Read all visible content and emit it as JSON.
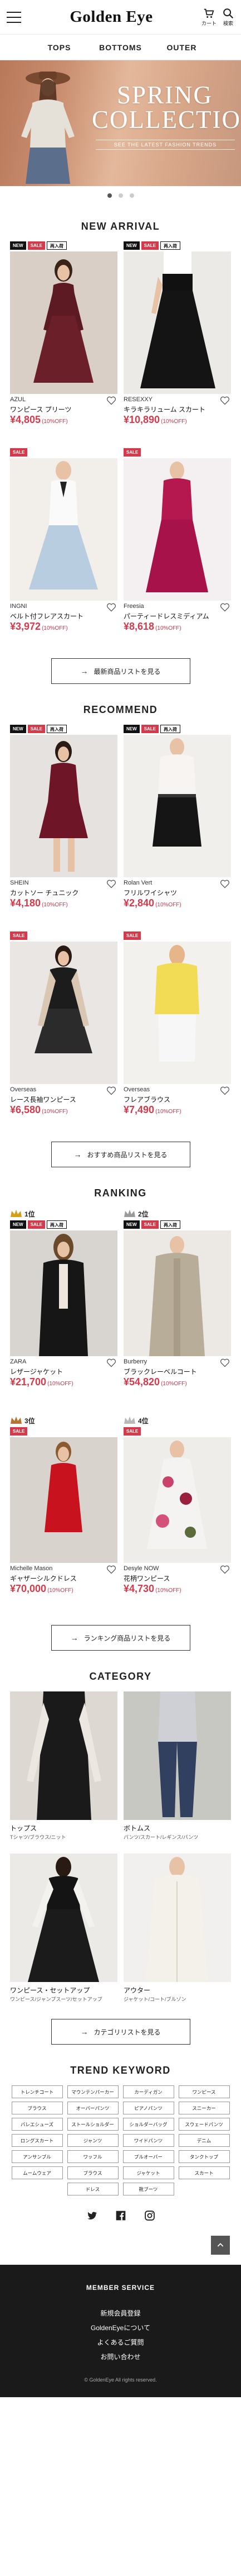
{
  "header": {
    "logo": "Golden Eye",
    "cart_label": "カート",
    "search_label": "検索"
  },
  "nav": {
    "tabs": [
      "TOPS",
      "BOTTOMS",
      "OUTER"
    ]
  },
  "hero": {
    "title_line1": "SPRING",
    "title_line2": "COLLECTION",
    "subtitle": "SEE THE LATEST FASHION TRENDS",
    "slides": 3,
    "active_slide": 0
  },
  "sections": {
    "new_arrival": {
      "title": "NEW ARRIVAL",
      "more_label": "最新商品リストを見る",
      "items": [
        {
          "badges": [
            "NEW",
            "SALE",
            "再入荷"
          ],
          "brand": "AZUL",
          "name": "ワンピース プリーツ",
          "price": "¥4,805",
          "off": "(10%OFF)"
        },
        {
          "badges": [
            "NEW",
            "SALE",
            "再入荷"
          ],
          "brand": "RESEXXY",
          "name": "キラキラリューム スカート",
          "price": "¥10,890",
          "off": "(10%OFF)"
        },
        {
          "badges": [
            "SALE"
          ],
          "brand": "INGNI",
          "name": "ベルト付フレアスカート",
          "price": "¥3,972",
          "off": "(10%OFF)"
        },
        {
          "badges": [
            "SALE"
          ],
          "brand": "Freesia",
          "name": "パーティードレスミディアム",
          "price": "¥8,618",
          "off": "(10%OFF)"
        }
      ]
    },
    "recommend": {
      "title": "RECOMMEND",
      "more_label": "おすすめ商品リストを見る",
      "items": [
        {
          "badges": [
            "NEW",
            "SALE",
            "再入荷"
          ],
          "brand": "SHEIN",
          "name": "カットソー チュニック",
          "price": "¥4,180",
          "off": "(10%OFF)"
        },
        {
          "badges": [
            "NEW",
            "SALE",
            "再入荷"
          ],
          "brand": "Rolan Vert",
          "name": "フリルワイシャツ",
          "price": "¥2,840",
          "off": "(10%OFF)"
        },
        {
          "badges": [
            "SALE"
          ],
          "brand": "Overseas",
          "name": "レース長袖ワンピース",
          "price": "¥6,580",
          "off": "(10%OFF)"
        },
        {
          "badges": [
            "SALE"
          ],
          "brand": "Overseas",
          "name": "フレアブラウス",
          "price": "¥7,490",
          "off": "(10%OFF)"
        }
      ]
    },
    "ranking": {
      "title": "RANKING",
      "more_label": "ランキング商品リストを見る",
      "items": [
        {
          "rank": "1位",
          "crown": "#d4a017",
          "badges": [
            "NEW",
            "SALE",
            "再入荷"
          ],
          "brand": "ZARA",
          "name": "レザージャケット",
          "price": "¥21,700",
          "off": "(10%OFF)"
        },
        {
          "rank": "2位",
          "crown": "#9a9a9a",
          "badges": [
            "NEW",
            "SALE",
            "再入荷"
          ],
          "brand": "Burberry",
          "name": "ブラックレーベルコート",
          "price": "¥54,820",
          "off": "(10%OFF)"
        },
        {
          "rank": "3位",
          "crown": "#b87333",
          "badges": [
            "SALE"
          ],
          "brand": "Michelle Mason",
          "name": "ギャザーシルクドレス",
          "price": "¥70,000",
          "off": "(10%OFF)"
        },
        {
          "rank": "4位",
          "crown": "#b8b8b8",
          "badges": [
            "SALE"
          ],
          "brand": "Desyle NOW",
          "name": "花柄ワンピース",
          "price": "¥4,730",
          "off": "(10%OFF)"
        }
      ]
    },
    "category": {
      "title": "CATEGORY",
      "more_label": "カテゴリリストを見る",
      "items": [
        {
          "name": "トップス",
          "sub": "Tシャツ/ブラウス/ニット"
        },
        {
          "name": "ボトムス",
          "sub": "パンツ/スカート/レギンス/パンツ"
        },
        {
          "name": "ワンピース・セットアップ",
          "sub": "ワンピース/ジャンプスーツ/セットアップ"
        },
        {
          "name": "アウター",
          "sub": "ジャケット/コート/ブルゾン"
        }
      ]
    },
    "trend": {
      "title": "TREND KEYWORD",
      "keywords": [
        "トレンチコート",
        "マウンテンパーカー",
        "カーディガン",
        "ワンピース",
        "ブラウス",
        "オーバーパンツ",
        "ピアノパンツ",
        "スニーカー",
        "バレエシューズ",
        "ストールショルダー",
        "ショルダーバッグ",
        "スウェードパンツ",
        "ロングスカート",
        "ジャンツ",
        "ワイドパンツ",
        "デニム",
        "アンサンブル",
        "ワッフル",
        "プルオーバー",
        "タンクトップ",
        "ムームウェア",
        "ブラウス",
        "ジャケット",
        "スカート",
        "ドレス",
        "靴ブーツ"
      ]
    }
  },
  "footer": {
    "title": "MEMBER SERVICE",
    "links": [
      "新規会員登録",
      "GoldenEyeについて",
      "よくあるご質問",
      "お問い合わせ"
    ],
    "copyright": "© GoldenEye All rights reserved."
  },
  "colors": {
    "sale_red": "#d63a4a",
    "footer_bg": "#1a1a1a"
  }
}
